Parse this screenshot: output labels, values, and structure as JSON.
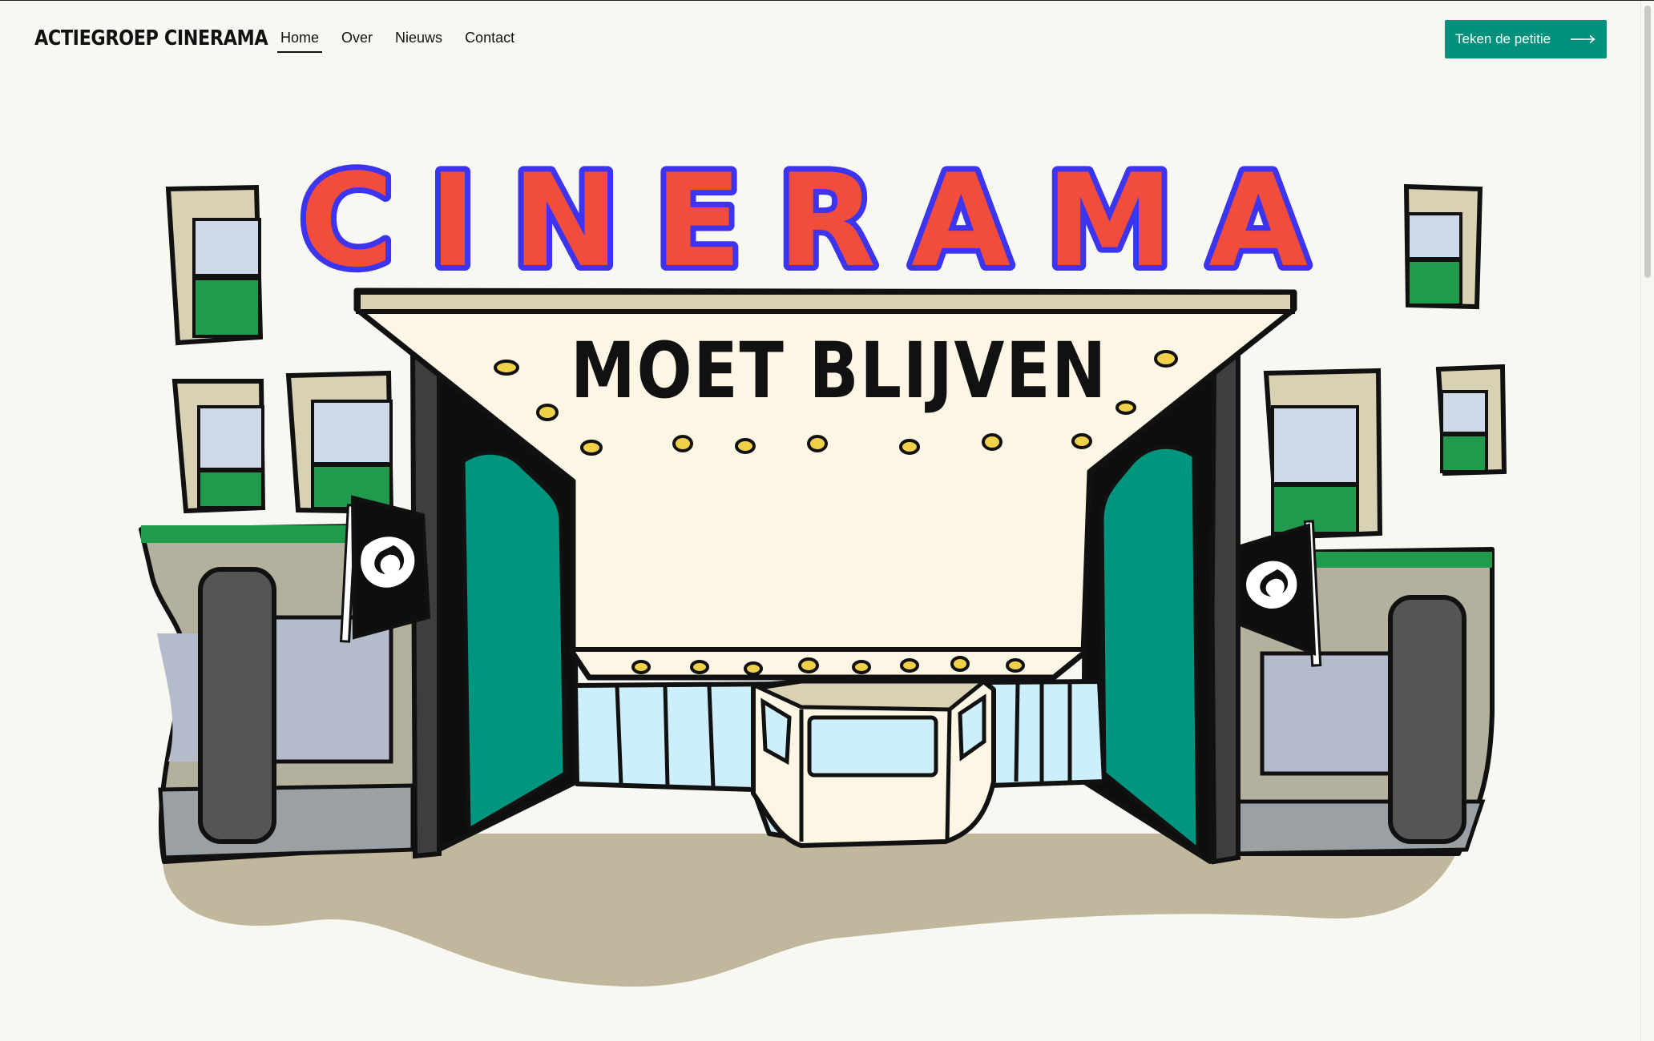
{
  "site": {
    "logo": "ACTIEGROEP CINERAMA"
  },
  "nav": {
    "items": [
      {
        "label": "Home",
        "active": true
      },
      {
        "label": "Over",
        "active": false
      },
      {
        "label": "Nieuws",
        "active": false
      },
      {
        "label": "Contact",
        "active": false
      }
    ]
  },
  "cta": {
    "label": "Teken de petitie",
    "icon": "arrow-right-icon"
  },
  "hero": {
    "sign_title": "CINERAMA",
    "sign_subtitle": "MOET BLIJVEN",
    "colors": {
      "teal": "#00957e",
      "green": "#229a4e",
      "cream": "#fdf6e4",
      "letter_fill": "#f24c3d",
      "letter_outline": "#3c34ee",
      "ground": "#c1b79c",
      "glass": "#cdeefb",
      "facade_gray": "#b4b09e",
      "window_blue": "#b4bccb"
    }
  }
}
